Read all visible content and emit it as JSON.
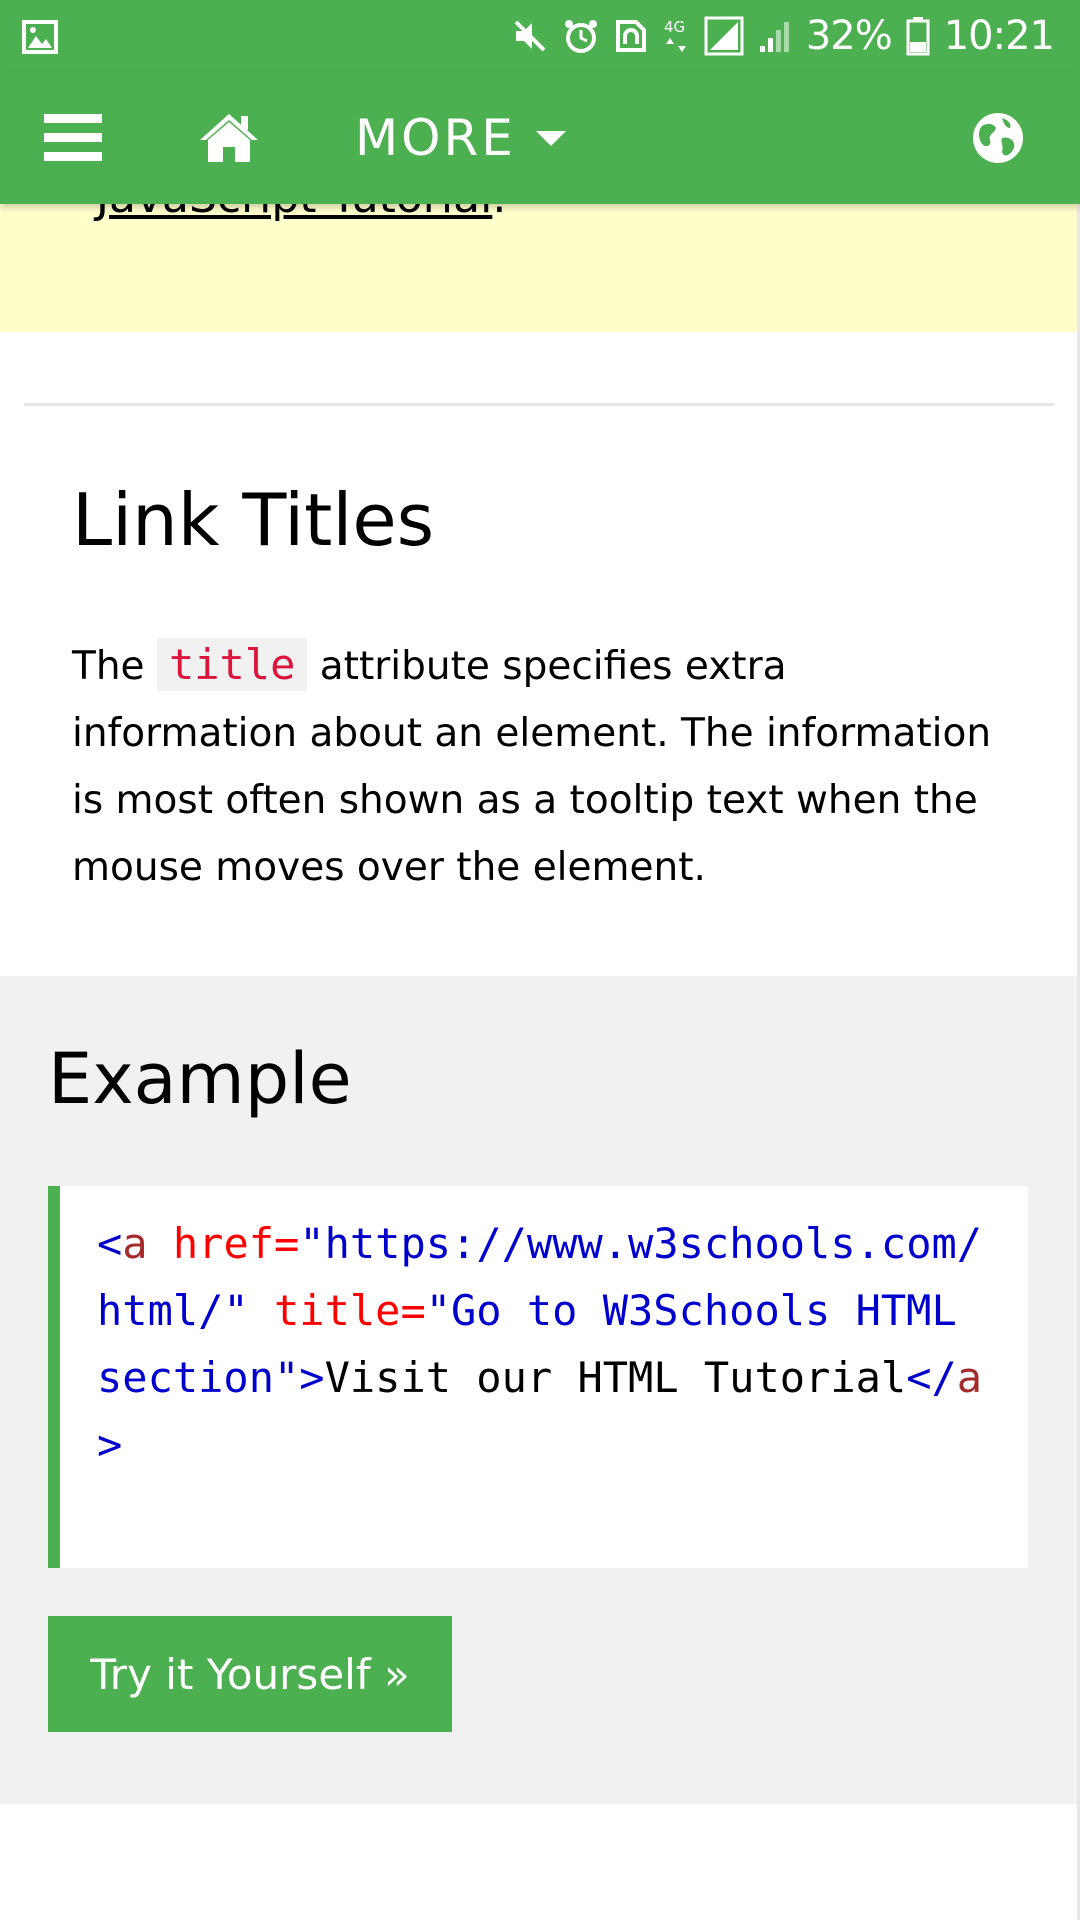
{
  "status_bar": {
    "battery": "32%",
    "time": "10:21",
    "network": "4G",
    "icons": [
      "gallery-icon",
      "mute-icon",
      "alarm-icon",
      "nfc-icon",
      "network-4g-icon",
      "sim-signal-icon",
      "signal-icon",
      "battery-icon"
    ]
  },
  "nav": {
    "menu_icon": "hamburger-menu-icon",
    "home_icon": "home-icon",
    "more_label": "MORE",
    "globe_icon": "globe-icon",
    "color": "#4caf50"
  },
  "note": {
    "link_text": "JavaScript Tutorial",
    "trailing": ".",
    "background": "#ffffcc"
  },
  "section": {
    "title": "Link Titles",
    "paragraph_before": "The ",
    "code": "title",
    "paragraph_after": " attribute specifies extra information about an element. The information is most often shown as a tooltip text when the mouse moves over the element."
  },
  "example": {
    "title": "Example",
    "code": {
      "open_bracket": "<",
      "tag": "a",
      "attr1": " href",
      "eq1": "=",
      "val1": "\"https://www.w3schools.com/html/\"",
      "attr2": " title",
      "eq2": "=",
      "val2": "\"Go to W3Schools HTML section\"",
      "close_bracket": ">",
      "text": "Visit our HTML Tutorial",
      "end_open": "</",
      "end_tag": "a",
      "end_close": ">"
    },
    "button_label": "Try it Yourself »"
  }
}
